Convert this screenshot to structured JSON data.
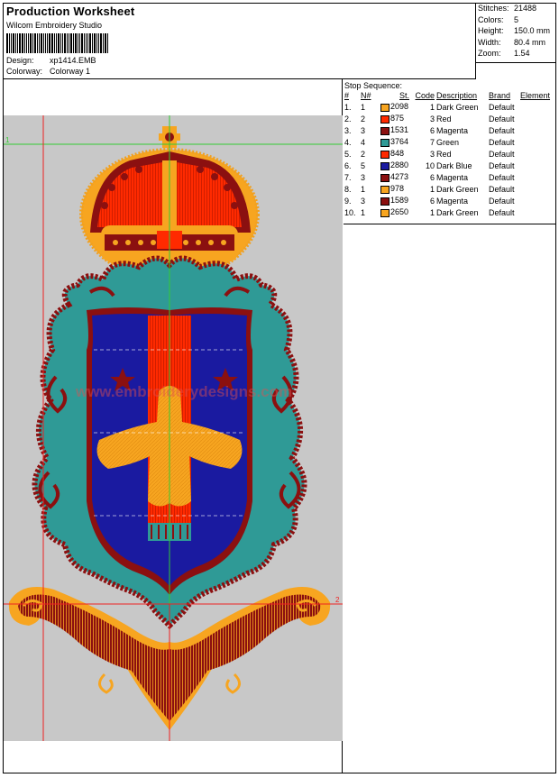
{
  "header": {
    "title": "Production Worksheet",
    "company": "Wilcom Embroidery Studio",
    "design_label": "Design:",
    "design_value": "xp1414.EMB",
    "colorway_label": "Colorway:",
    "colorway_value": "Colorway 1"
  },
  "stats": [
    {
      "label": "Stitches:",
      "value": "21488"
    },
    {
      "label": "Colors:",
      "value": "5"
    },
    {
      "label": "Height:",
      "value": "150.0 mm"
    },
    {
      "label": "Width:",
      "value": "80.4 mm"
    },
    {
      "label": "Zoom:",
      "value": "1.54"
    }
  ],
  "canvas": {
    "watermark": "www.embroiderydesigns.com",
    "marker_1": "1",
    "marker_2": "2"
  },
  "stop_sequence": {
    "title": "Stop Sequence:",
    "headers": {
      "index": "#",
      "needle": "N#",
      "stitches": "St.",
      "code": "Code",
      "description": "Description",
      "brand": "Brand",
      "element": "Element"
    },
    "rows": [
      {
        "index": "1.",
        "needle": "1",
        "color": "#f7a520",
        "stitches": "2098",
        "code": "1",
        "description": "Dark Green",
        "brand": "Default"
      },
      {
        "index": "2.",
        "needle": "2",
        "color": "#ff2a00",
        "stitches": "875",
        "code": "3",
        "description": "Red",
        "brand": "Default"
      },
      {
        "index": "3.",
        "needle": "3",
        "color": "#8b1010",
        "stitches": "1531",
        "code": "6",
        "description": "Magenta",
        "brand": "Default"
      },
      {
        "index": "4.",
        "needle": "4",
        "color": "#2f9a96",
        "stitches": "3764",
        "code": "7",
        "description": "Green",
        "brand": "Default"
      },
      {
        "index": "5.",
        "needle": "2",
        "color": "#ff2a00",
        "stitches": "848",
        "code": "3",
        "description": "Red",
        "brand": "Default"
      },
      {
        "index": "6.",
        "needle": "5",
        "color": "#1a1aa0",
        "stitches": "2880",
        "code": "10",
        "description": "Dark Blue",
        "brand": "Default"
      },
      {
        "index": "7.",
        "needle": "3",
        "color": "#8b1010",
        "stitches": "4273",
        "code": "6",
        "description": "Magenta",
        "brand": "Default"
      },
      {
        "index": "8.",
        "needle": "1",
        "color": "#f7a520",
        "stitches": "978",
        "code": "1",
        "description": "Dark Green",
        "brand": "Default"
      },
      {
        "index": "9.",
        "needle": "3",
        "color": "#8b1010",
        "stitches": "1589",
        "code": "6",
        "description": "Magenta",
        "brand": "Default"
      },
      {
        "index": "10.",
        "needle": "1",
        "color": "#f7a520",
        "stitches": "2650",
        "code": "1",
        "description": "Dark Green",
        "brand": "Default"
      }
    ]
  },
  "colors": {
    "orange": "#f7a520",
    "red": "#ff2a00",
    "maroon": "#8b1010",
    "teal": "#2f9a96",
    "blue": "#1a1aa0",
    "canvas_bg": "#c8c8c8",
    "guide_green": "#33cc33",
    "guide_red": "#ee2222"
  }
}
